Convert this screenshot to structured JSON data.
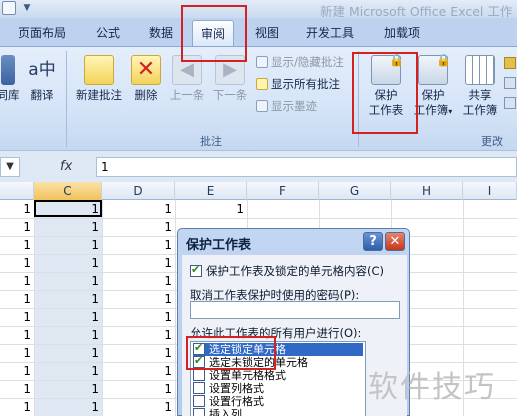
{
  "window": {
    "title": "新建 Microsoft Office Excel 工作"
  },
  "tabs": [
    {
      "label": "页面布局"
    },
    {
      "label": "公式"
    },
    {
      "label": "数据"
    },
    {
      "label": "审阅"
    },
    {
      "label": "视图"
    },
    {
      "label": "开发工具"
    },
    {
      "label": "加载项"
    }
  ],
  "ribbon": {
    "proofing": {
      "thesaurus_label": "同库",
      "translate_label": "翻译"
    },
    "comments": {
      "group_label": "批注",
      "new_comment": "新建批注",
      "delete": "删除",
      "previous": "上一条",
      "next": "下一条",
      "show_hide": "显示/隐藏批注",
      "show_all": "显示所有批注",
      "show_ink": "显示墨迹"
    },
    "changes": {
      "group_label": "更改",
      "protect_sheet_l1": "保护",
      "protect_sheet_l2": "工作表",
      "protect_workbook_l1": "保护",
      "protect_workbook_l2": "工作簿",
      "share_workbook_l1": "共享",
      "share_workbook_l2": "工作簿"
    }
  },
  "formula_bar": {
    "fx": "fx",
    "value": "1"
  },
  "grid": {
    "columns": [
      "C",
      "D",
      "E",
      "F",
      "G",
      "H",
      "I"
    ],
    "selected_column": "C"
  },
  "dialog": {
    "title": "保护工作表",
    "help_button": "?",
    "close_button": "✕",
    "protect_checkbox_label": "保护工作表及锁定的单元格内容(C)",
    "password_label": "取消工作表保护时使用的密码(P):",
    "password_value": "",
    "allow_label": "允许此工作表的所有用户进行(O):",
    "options": [
      {
        "label": "选定锁定单元格",
        "checked": true,
        "highlighted": true
      },
      {
        "label": "选定未锁定的单元格",
        "checked": true,
        "highlighted": false
      },
      {
        "label": "设置单元格格式",
        "checked": false,
        "highlighted": false
      },
      {
        "label": "设置列格式",
        "checked": false,
        "highlighted": false
      },
      {
        "label": "设置行格式",
        "checked": false,
        "highlighted": false
      },
      {
        "label": "插入列",
        "checked": false,
        "highlighted": false
      }
    ]
  },
  "watermark": "软件技巧"
}
